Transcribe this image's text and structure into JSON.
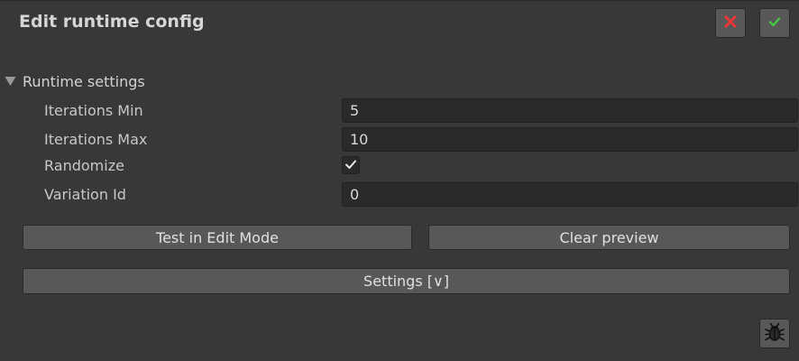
{
  "header": {
    "title": "Edit runtime config",
    "cancel_icon": "close-x-icon",
    "confirm_icon": "checkmark-icon",
    "cancel_color": "#e53935",
    "confirm_color": "#43c943"
  },
  "section": {
    "label": "Runtime settings",
    "expanded": true
  },
  "fields": {
    "iterations_min": {
      "label": "Iterations Min",
      "value": "5"
    },
    "iterations_max": {
      "label": "Iterations Max",
      "value": "10"
    },
    "randomize": {
      "label": "Randomize",
      "checked": true
    },
    "variation_id": {
      "label": "Variation Id",
      "value": "0"
    }
  },
  "buttons": {
    "test_label": "Test in Edit Mode",
    "clear_label": "Clear preview",
    "settings_label": "Settings [∨]"
  },
  "footer": {
    "debug_icon": "bug-icon"
  }
}
